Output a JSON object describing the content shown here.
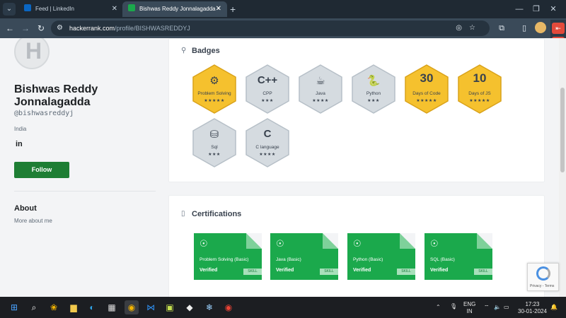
{
  "browser": {
    "tabs": [
      {
        "title": "Feed | LinkedIn",
        "favicon_color": "#0a66c2",
        "active": false
      },
      {
        "title": "Bishwas Reddy Jonnalagadda -",
        "favicon_color": "#1ba94c",
        "active": true
      }
    ],
    "url_host": "hackerrank.com",
    "url_path": "/profile/BISHWASREDDYJ"
  },
  "profile": {
    "avatar_letter": "H",
    "name": "Bishwas Reddy Jonnalagadda",
    "handle": "@bishwasreddyj",
    "country": "India",
    "social_icon_text": "in",
    "follow_label": "Follow",
    "about_heading": "About",
    "about_text": "More about me"
  },
  "badges_section": {
    "title": "Badges",
    "badges": [
      {
        "name": "Problem Solving",
        "icon_text": "⚙",
        "number": "",
        "stars": "★★★★★",
        "gold": true
      },
      {
        "name": "CPP",
        "icon_text": "C++",
        "number": "",
        "stars": "★★★",
        "gold": false
      },
      {
        "name": "Java",
        "icon_text": "☕",
        "number": "",
        "stars": "★★★★",
        "gold": false
      },
      {
        "name": "Python",
        "icon_text": "🐍",
        "number": "",
        "stars": "★★★",
        "gold": false
      },
      {
        "name": "Days of Code",
        "icon_text": "",
        "number": "30",
        "stars": "★★★★★",
        "gold": true
      },
      {
        "name": "Days of JS",
        "icon_text": "",
        "number": "10",
        "stars": "★★★★★",
        "gold": true
      },
      {
        "name": "Sql",
        "icon_text": "⛁",
        "number": "",
        "stars": "★★★",
        "gold": false
      },
      {
        "name": "C language",
        "icon_text": "C",
        "number": "",
        "stars": "★★★★",
        "gold": false
      }
    ]
  },
  "certifications_section": {
    "title": "Certifications",
    "certificates": [
      {
        "name": "Problem Solving (Basic)",
        "status": "Verified",
        "tag": "SKILL"
      },
      {
        "name": "Java (Basic)",
        "status": "Verified",
        "tag": "SKILL"
      },
      {
        "name": "Python (Basic)",
        "status": "Verified",
        "tag": "SKILL"
      },
      {
        "name": "SQL (Basic)",
        "status": "Verified",
        "tag": "SKILL"
      }
    ]
  },
  "recaptcha": {
    "text": "Privacy - Terms"
  },
  "taskbar": {
    "lang_line1": "ENG",
    "lang_line2": "IN",
    "time": "17:23",
    "date": "30-01-2024"
  },
  "colors": {
    "gold_badge": "#f5c12e",
    "silver_badge": "#d5dbe0",
    "cert_green": "#1ba94c",
    "follow_green": "#1e7e34"
  }
}
